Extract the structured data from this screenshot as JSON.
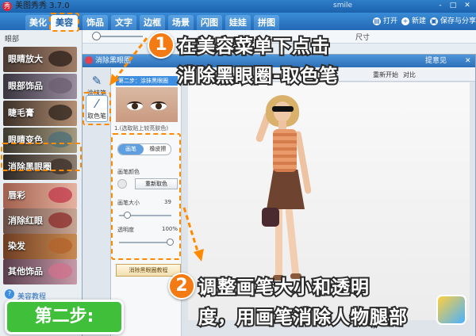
{
  "app": {
    "title": "美图秀秀 3.7.0",
    "user": "smile",
    "window_controls": [
      "-",
      "□",
      "✕"
    ]
  },
  "tabs": [
    "美化",
    "美容",
    "饰品",
    "文字",
    "边框",
    "场景",
    "闪图",
    "娃娃",
    "拼图"
  ],
  "active_tab": "美容",
  "toolbar_actions": {
    "open": "打开",
    "new": "新建",
    "save_share": "保存与分享"
  },
  "slider_strip": {
    "size_label": "尺寸"
  },
  "left_panel": {
    "eye_section": "眼部",
    "eye_items": [
      "眼睛放大",
      "眼部饰品",
      "睫毛膏",
      "眼睛变色",
      "消除黑眼圈"
    ],
    "mouth_items": [
      "唇彩",
      "消除红眼",
      "染发",
      "其他饰品"
    ],
    "tutorial_link": "美容教程"
  },
  "dialog": {
    "title": "消除黑眼圈",
    "help": "提意见",
    "tools": [
      "涂抹笔",
      "取色笔"
    ],
    "step_header": "第二步：涂抹黑眼圈",
    "step_caption": "1.(选取贴上较亮肤色)",
    "modes": [
      "画笔",
      "橡皮擦"
    ],
    "brush_color_label": "画笔颜色",
    "repick_label": "重新取色",
    "brush_size_label": "画笔大小",
    "brush_size_value": "39",
    "opacity_label": "透明度",
    "opacity_value": "100%",
    "demo_label": "消除黑眼圈教程",
    "reset_label": "重新开始",
    "compare_label": "对比"
  },
  "callouts": {
    "step1_number": "1",
    "step1_line1": "在美容菜单下点击",
    "step1_line2": "消除黑眼圈-取色笔",
    "step2_number": "2",
    "step2_line1": "调整画笔大小和透明",
    "step2_line2": "度，用画笔消除人物腿部",
    "badge": "第二步:"
  },
  "colors": {
    "accent_blue": "#2368b4",
    "highlight_orange": "#ff8a00",
    "badge_green": "#3fbf3a"
  }
}
